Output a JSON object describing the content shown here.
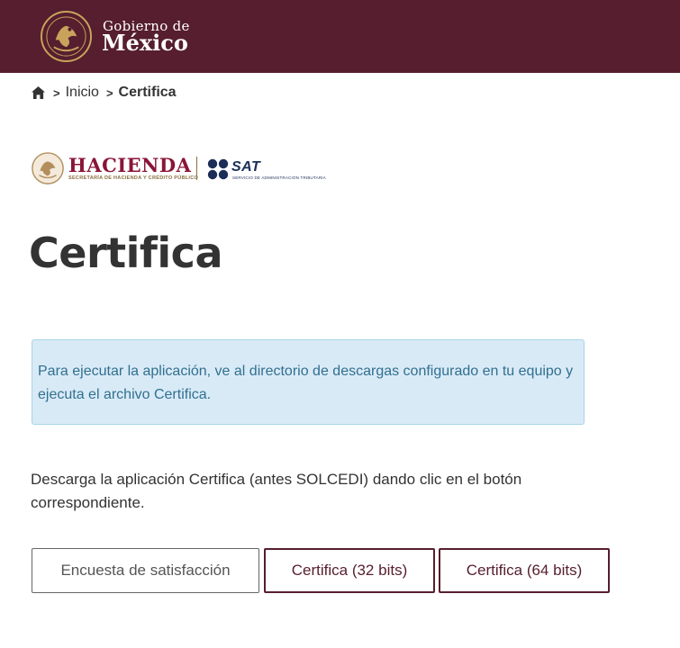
{
  "header": {
    "gob_line1": "Gobierno de",
    "gob_line2": "México",
    "colors": {
      "bar": "#561e2e",
      "gold": "#c9a35b"
    },
    "seal_icon": "mexico-coat-of-arms-icon"
  },
  "breadcrumb": {
    "home_icon": "home-icon",
    "items": [
      "Inicio",
      "Certifica"
    ]
  },
  "logos": {
    "hacienda": "HACIENDA",
    "hacienda_sub": "SECRETARÍA DE HACIENDA Y CRÉDITO PÚBLICO",
    "sat": "SAT",
    "sat_sub": "SERVICIO DE ADMINISTRACIÓN TRIBUTARIA"
  },
  "page_title": "Certifica",
  "alert": {
    "text": "Para ejecutar la aplicación, ve al directorio de descargas configurado en tu equipo y ejecuta el archivo Certifica."
  },
  "description": "Descarga la aplicación Certifica (antes SOLCEDI) dando clic en el botón correspondiente.",
  "buttons": {
    "survey": "Encuesta de satisfacción",
    "bits32": "Certifica (32 bits)",
    "bits64": "Certifica (64 bits)"
  }
}
